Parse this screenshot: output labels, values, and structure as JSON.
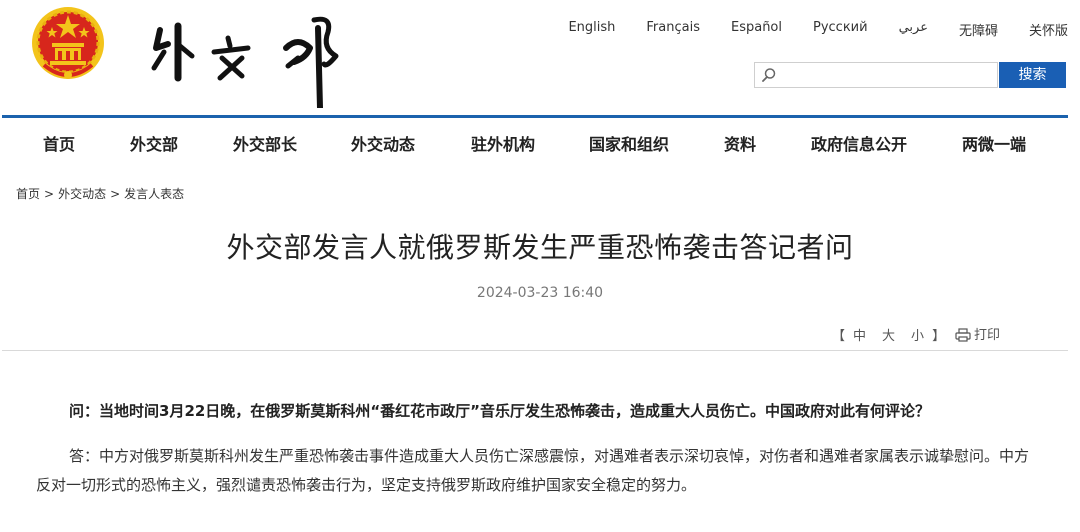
{
  "header": {
    "site_name": "外交部",
    "languages": [
      "English",
      "Français",
      "Español",
      "Русский",
      "عربي",
      "无障碍",
      "关怀版"
    ],
    "search": {
      "placeholder": "",
      "button_label": "搜索"
    }
  },
  "nav": {
    "items": [
      "首页",
      "外交部",
      "外交部长",
      "外交动态",
      "驻外机构",
      "国家和组织",
      "资料",
      "政府信息公开",
      "两微一端"
    ]
  },
  "breadcrumb": {
    "items": [
      "首页",
      "外交动态",
      "发言人表态"
    ],
    "separator": ">"
  },
  "article": {
    "title": "外交部发言人就俄罗斯发生严重恐怖袭击答记者问",
    "date": "2024-03-23 16:40",
    "font_sizes": {
      "open": "【",
      "large": "中",
      "medium": "大",
      "small": "小",
      "close": "】"
    },
    "print_label": "打印",
    "question": "问：当地时间3月22日晚，在俄罗斯莫斯科州“番红花市政厅”音乐厅发生恐怖袭击，造成重大人员伤亡。中国政府对此有何评论？",
    "answer": "答：中方对俄罗斯莫斯科州发生严重恐怖袭击事件造成重大人员伤亡深感震惊，对遇难者表示深切哀悼，对伤者和遇难者家属表示诚挚慰问。中方反对一切形式的恐怖主义，强烈谴责恐怖袭击行为，坚定支持俄罗斯政府维护国家安全稳定的努力。"
  },
  "colors": {
    "accent": "#1b62ad",
    "search_button": "#1a5fb4",
    "emblem_red": "#d7261c",
    "emblem_gold": "#f3c41b"
  }
}
